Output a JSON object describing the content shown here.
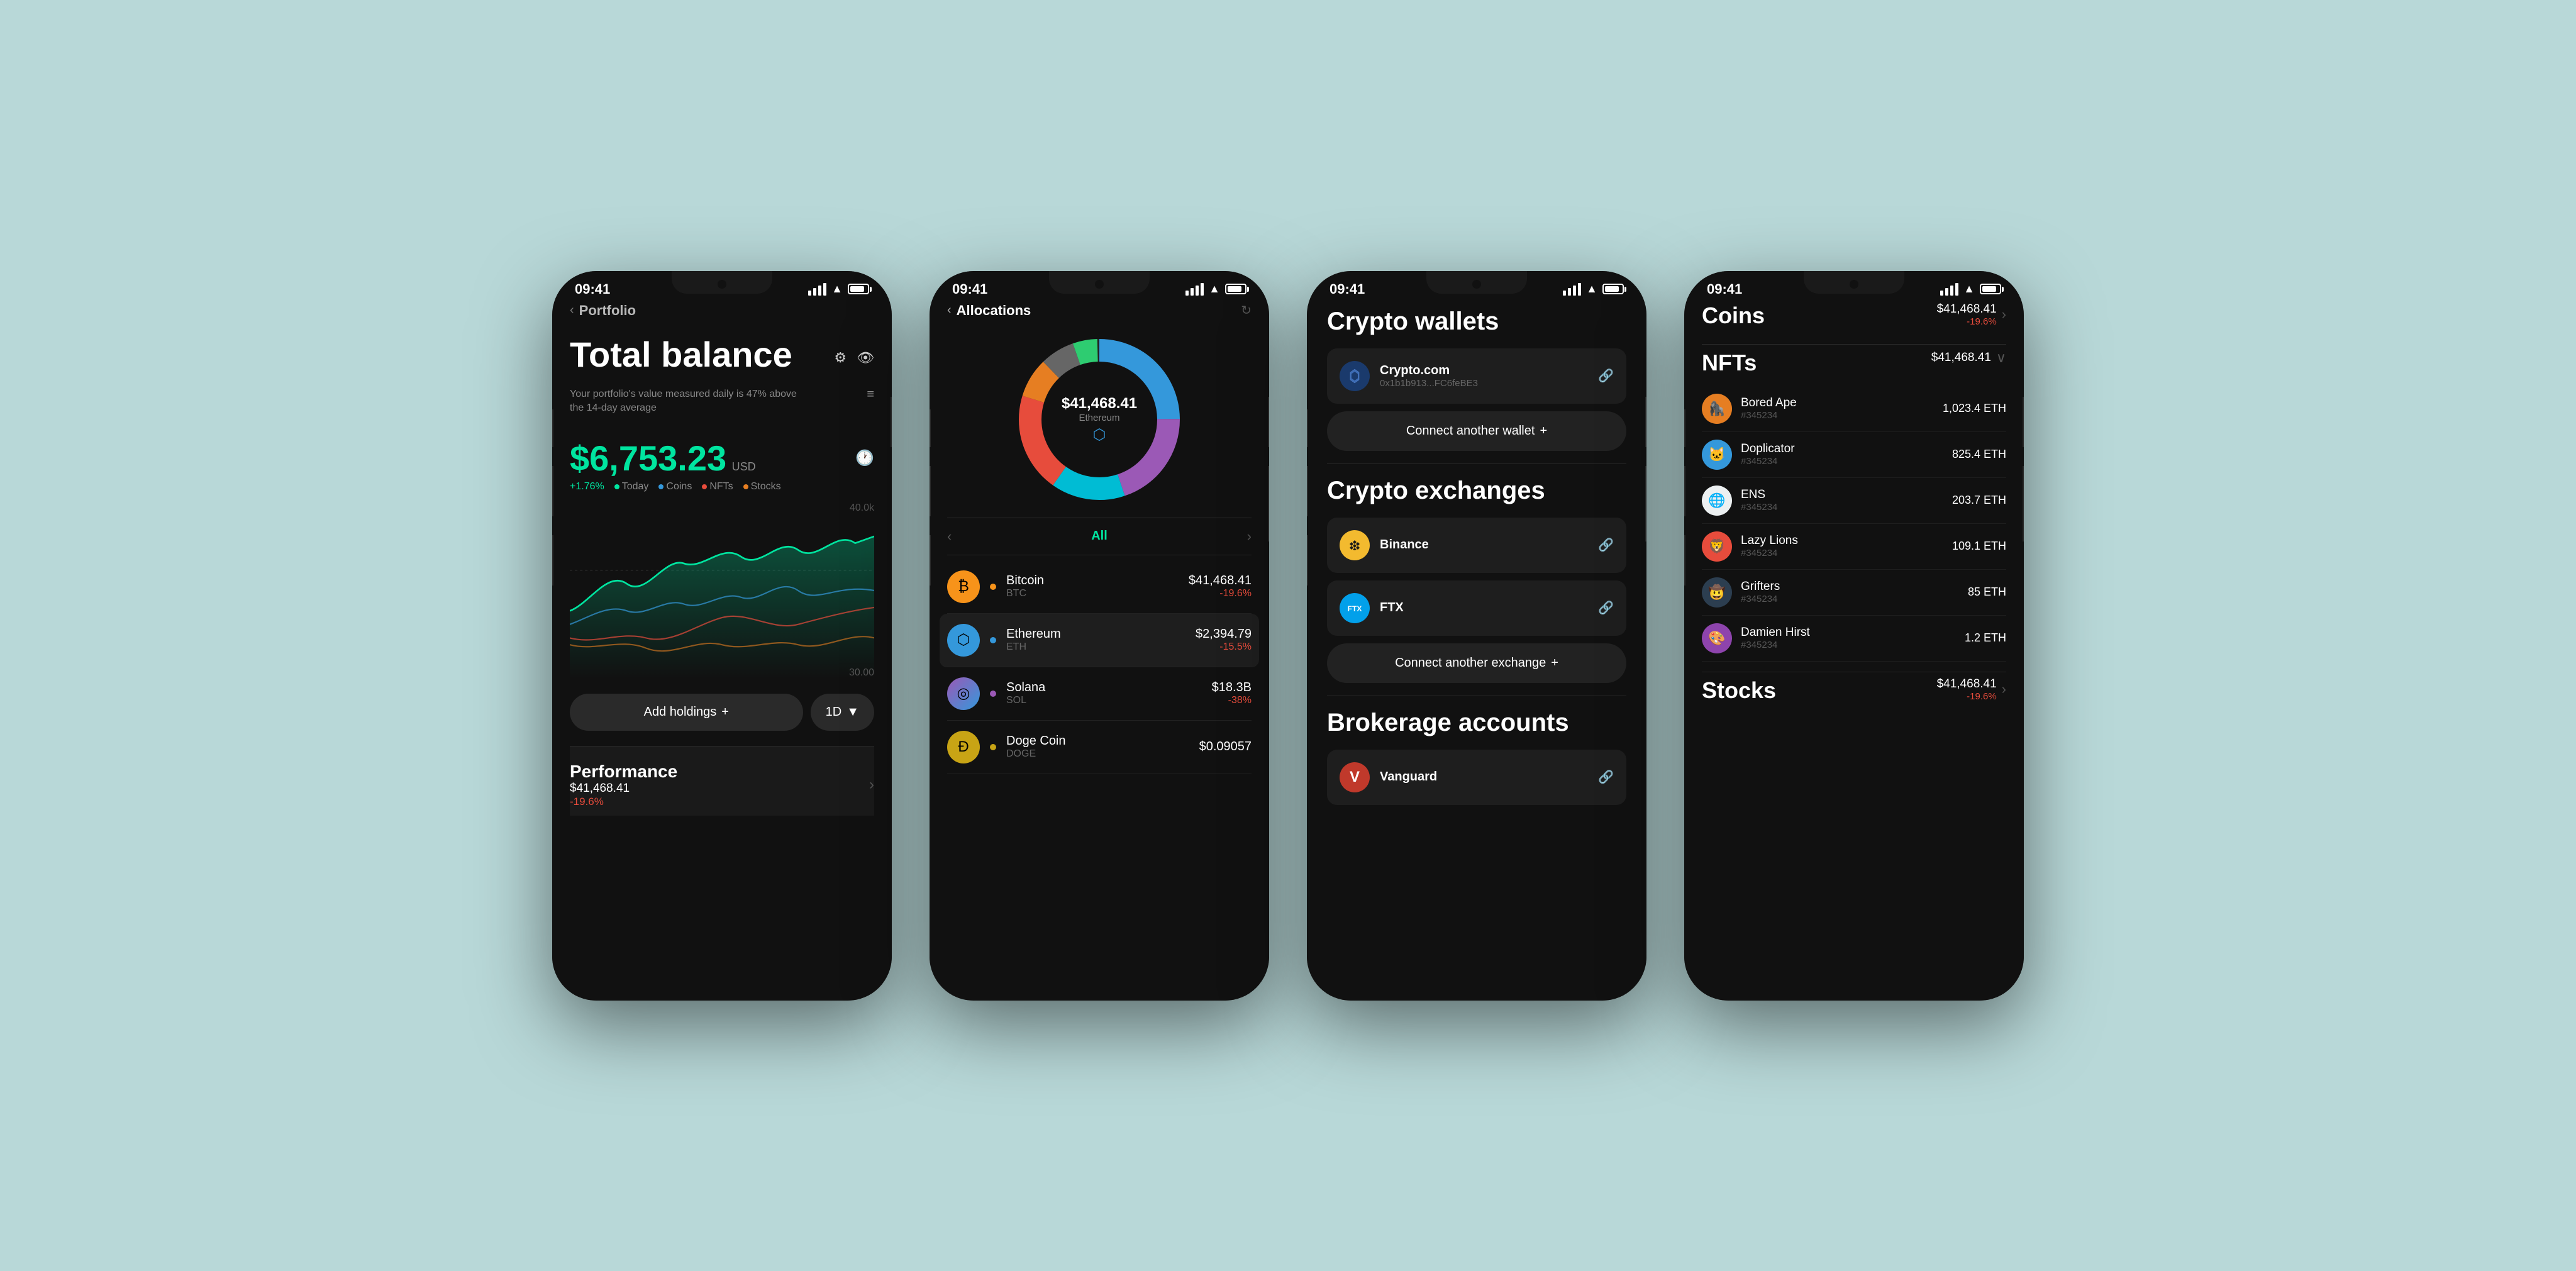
{
  "background": "#b8d8d8",
  "phones": [
    {
      "id": "phone1",
      "screen": "portfolio",
      "status": {
        "time": "09:41",
        "signal": true,
        "wifi": true,
        "battery": 85
      },
      "nav": {
        "back": "<",
        "title": "Portfolio"
      },
      "total_balance": {
        "label": "Total balance",
        "settings_icon": "⚙",
        "eye_icon": "👁",
        "subtitle": "Your portfolio's value measured daily is 47% above the 14-day average",
        "amount": "$6,753.23",
        "currency": "USD",
        "change_pct": "+1.76%",
        "legend": [
          {
            "label": "Today",
            "color": "#00e5a0"
          },
          {
            "label": "Coins",
            "color": "#3498db"
          },
          {
            "label": "NFTs",
            "color": "#e74c3c"
          },
          {
            "label": "Stocks",
            "color": "#e67e22"
          }
        ],
        "chart_high": "40.0k",
        "chart_low": "30.00"
      },
      "buttons": {
        "add": "Add holdings",
        "period": "1D"
      },
      "performance": {
        "label": "Performance",
        "value": "$41,468.41",
        "change": "-19.6%"
      }
    },
    {
      "id": "phone2",
      "screen": "allocations",
      "status": {
        "time": "09:41",
        "signal": true,
        "wifi": true,
        "battery": 85
      },
      "nav": {
        "back": "<",
        "title": "Allocations"
      },
      "donut": {
        "amount": "$41,468.41",
        "label": "Ethereum",
        "icon": "⬡",
        "segments": [
          {
            "color": "#3498db",
            "pct": 25
          },
          {
            "color": "#9b59b6",
            "pct": 20
          },
          {
            "color": "#00bcd4",
            "pct": 15
          },
          {
            "color": "#e74c3c",
            "pct": 20
          },
          {
            "color": "#e67e22",
            "pct": 8
          },
          {
            "color": "#888",
            "pct": 7
          },
          {
            "color": "#2ecc71",
            "pct": 5
          }
        ]
      },
      "filter": {
        "prev": "<",
        "label": "All",
        "next": ">"
      },
      "coins": [
        {
          "name": "Bitcoin",
          "ticker": "BTC",
          "color": "#f7931a",
          "bg": "#f7931a",
          "icon": "₿",
          "value": "$41,468.41",
          "change": "-19.6%"
        },
        {
          "name": "Ethereum",
          "ticker": "ETH",
          "color": "#3498db",
          "bg": "#3498db",
          "icon": "⬡",
          "value": "$2,394.79",
          "change": "-15.5%",
          "selected": true
        },
        {
          "name": "Solana",
          "ticker": "SOL",
          "color": "#9b59b6",
          "bg": "#9b59b6",
          "icon": "◎",
          "value": "$18.3B",
          "change": "-38%"
        },
        {
          "name": "Doge Coin",
          "ticker": "DOGE",
          "color": "#c8a415",
          "bg": "#c8a415",
          "icon": "Ð",
          "value": "$0.09057",
          "change": ""
        }
      ]
    },
    {
      "id": "phone3",
      "screen": "connections",
      "status": {
        "time": "09:41",
        "signal": true,
        "wifi": true,
        "battery": 85
      },
      "crypto_wallets": {
        "title": "Crypto wallets",
        "wallets": [
          {
            "name": "Crypto.com",
            "address": "0x1b1b913...FC6feBE3",
            "icon": "🔵"
          }
        ],
        "connect_btn": "Connect another wallet"
      },
      "crypto_exchanges": {
        "title": "Crypto exchanges",
        "exchanges": [
          {
            "name": "Binance",
            "icon": "🟡"
          },
          {
            "name": "FTX",
            "icon": "🔷"
          }
        ],
        "connect_btn": "Connect another exchange"
      },
      "brokerage": {
        "title": "Brokerage accounts",
        "accounts": [
          {
            "name": "Vanguard",
            "icon": "V",
            "icon_bg": "#c0392b"
          }
        ]
      }
    },
    {
      "id": "phone4",
      "screen": "assets",
      "status": {
        "time": "09:41",
        "signal": true,
        "wifi": true,
        "battery": 85
      },
      "sections": {
        "coins": {
          "title": "Coins",
          "value": "$41,468.41",
          "change": "-19.6%",
          "arrow": ">"
        },
        "nfts": {
          "title": "NFTs",
          "value": "$41,468.41",
          "arrow": "∨",
          "items": [
            {
              "name": "Bored Ape",
              "id": "#345234",
              "value": "1,023.4 ETH",
              "color": "#e67e22",
              "emoji": "🦍"
            },
            {
              "name": "Doplicator",
              "id": "#345234",
              "value": "825.4 ETH",
              "color": "#3498db",
              "emoji": "🐱"
            },
            {
              "name": "ENS",
              "id": "#345234",
              "value": "203.7 ETH",
              "color": "#ecf0f1",
              "emoji": "🌐"
            },
            {
              "name": "Lazy Lions",
              "id": "#345234",
              "value": "109.1 ETH",
              "color": "#e74c3c",
              "emoji": "🦁"
            },
            {
              "name": "Grifters",
              "id": "#345234",
              "value": "85 ETH",
              "color": "#2c3e50",
              "emoji": "🤠"
            },
            {
              "name": "Damien Hirst",
              "id": "#345234",
              "value": "1.2 ETH",
              "color": "#8e44ad",
              "emoji": "🎨"
            }
          ]
        },
        "stocks": {
          "title": "Stocks",
          "value": "$41,468.41",
          "change": "-19.6%",
          "arrow": ">"
        }
      }
    }
  ]
}
